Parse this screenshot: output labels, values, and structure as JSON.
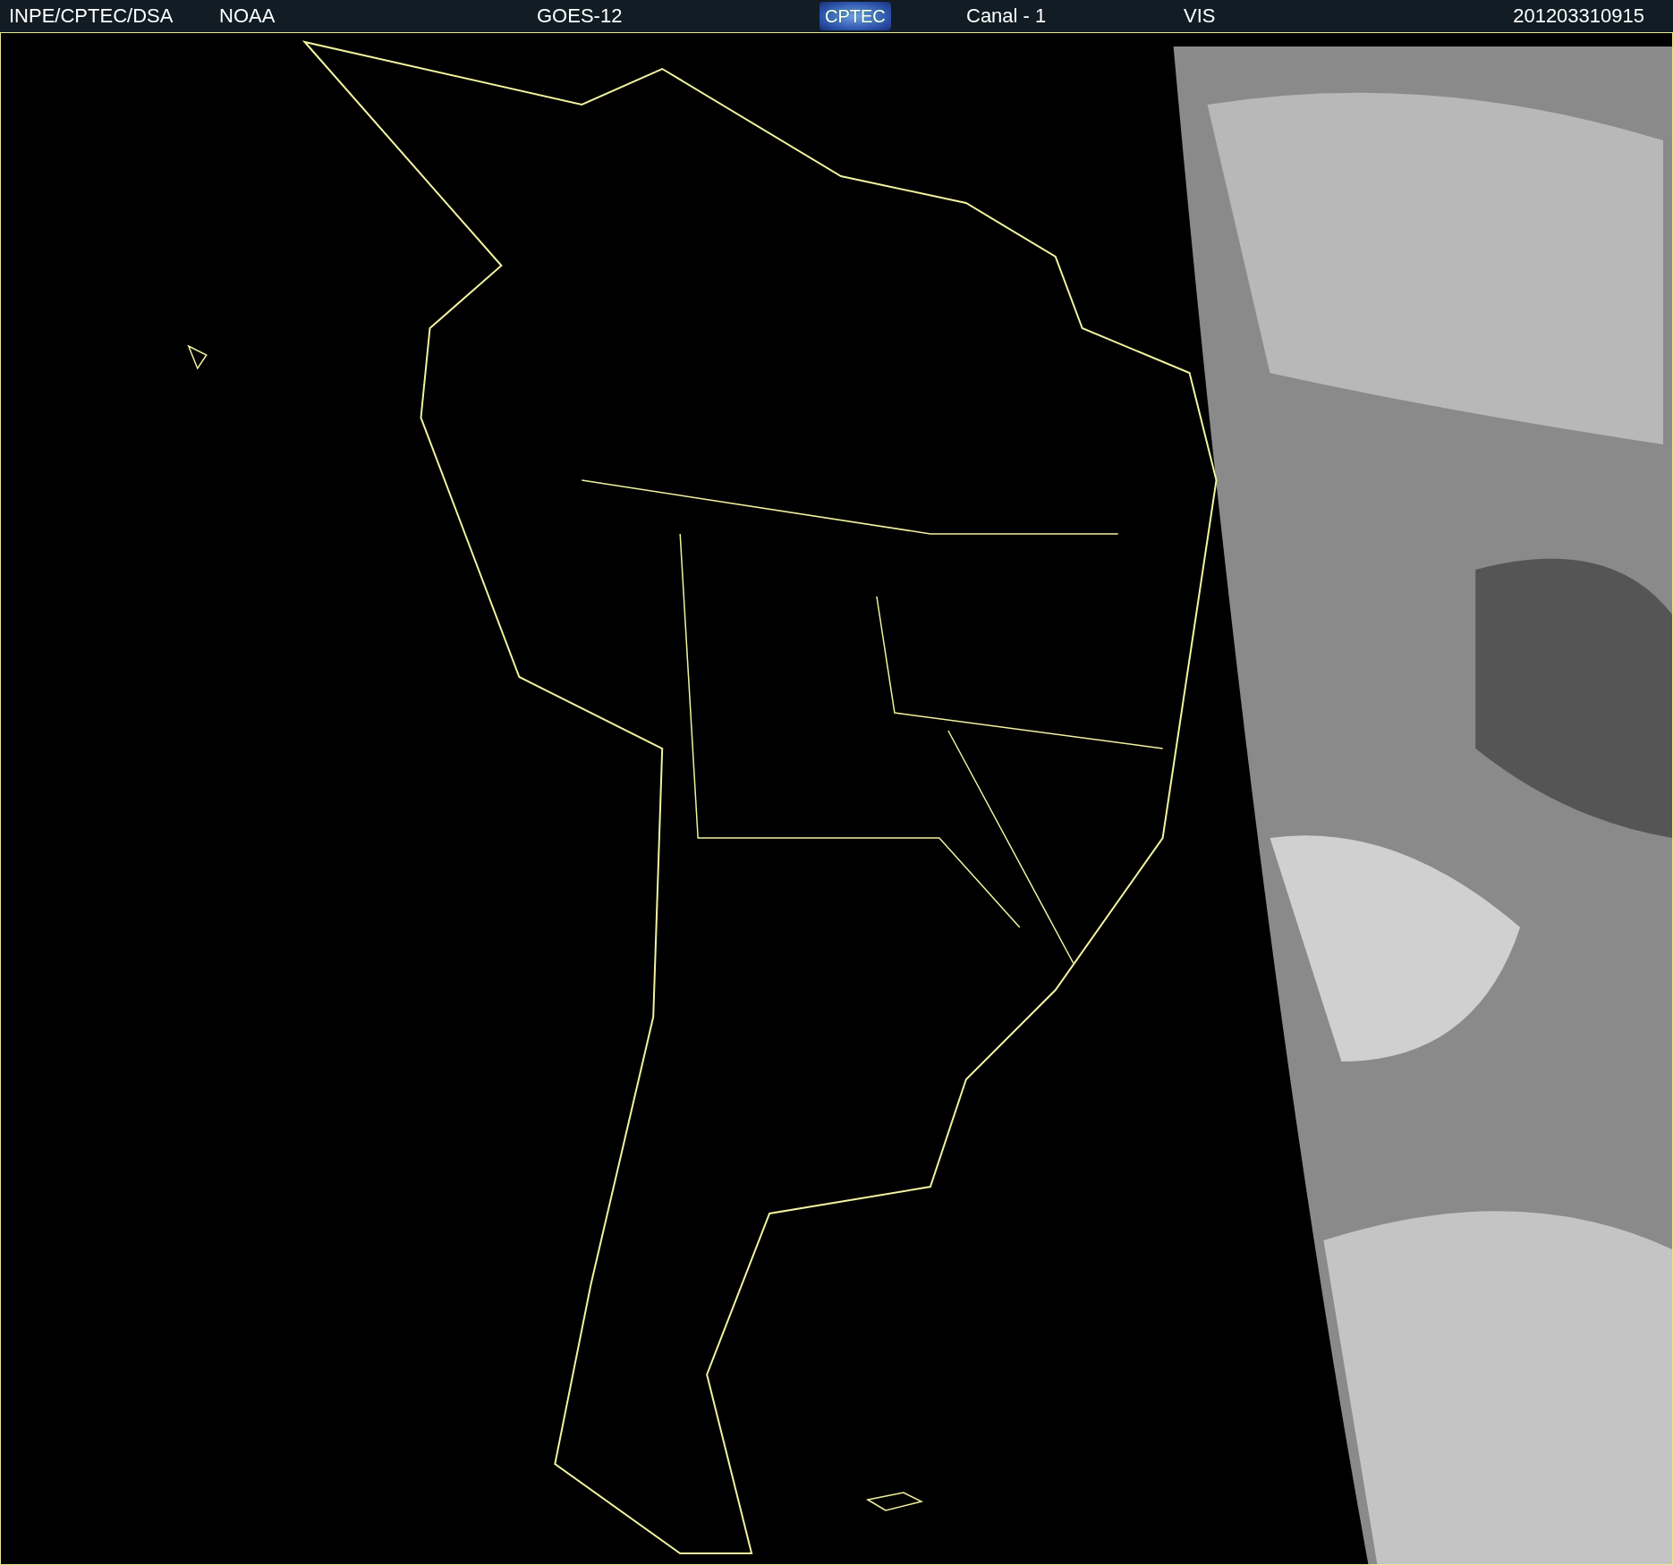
{
  "header": {
    "items": [
      {
        "kind": "text",
        "text": "INPE/CPTEC/DSA"
      },
      {
        "kind": "text",
        "text": "NOAA"
      },
      {
        "kind": "text",
        "text": "GOES-12"
      },
      {
        "kind": "logo",
        "text": "CPTEC"
      },
      {
        "kind": "text",
        "text": "Canal - 1"
      },
      {
        "kind": "text",
        "text": "VIS"
      },
      {
        "kind": "text",
        "text": "201203310915"
      }
    ]
  }
}
